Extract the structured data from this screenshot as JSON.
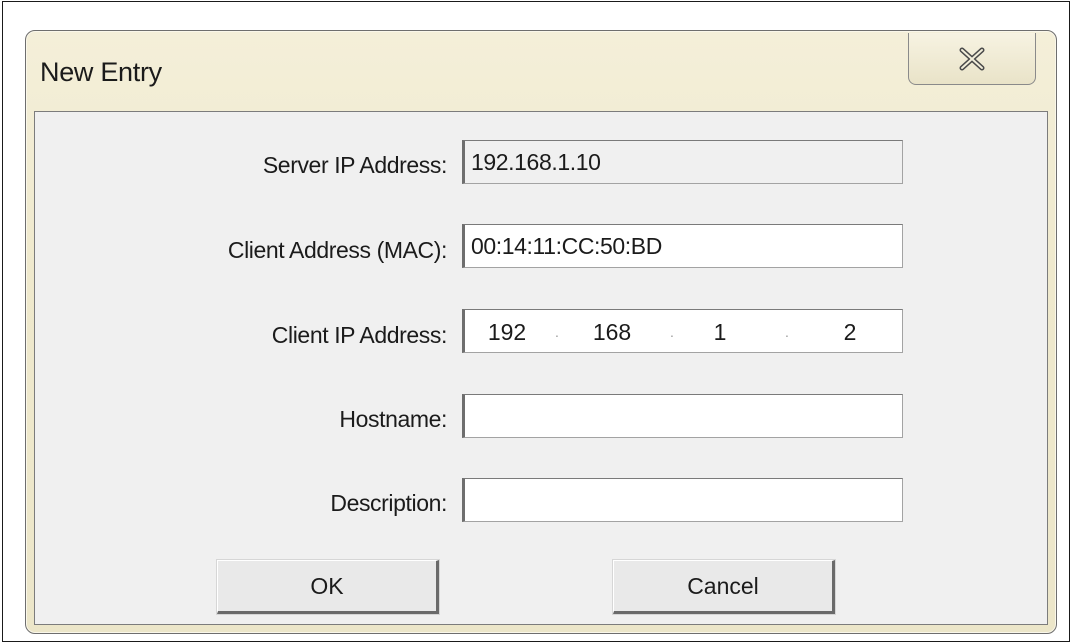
{
  "window": {
    "title": "New Entry",
    "close_icon": "close-x-icon"
  },
  "form": {
    "server_ip_label": "Server IP Address:",
    "server_ip_value": "192.168.1.10",
    "mac_label": "Client Address (MAC):",
    "mac_value": "00:14:11:CC:50:BD",
    "client_ip_label": "Client IP Address:",
    "client_ip_octets": [
      "192",
      "168",
      "1",
      "2"
    ],
    "hostname_label": "Hostname:",
    "hostname_value": "",
    "description_label": "Description:",
    "description_value": ""
  },
  "buttons": {
    "ok_label": "OK",
    "cancel_label": "Cancel"
  }
}
